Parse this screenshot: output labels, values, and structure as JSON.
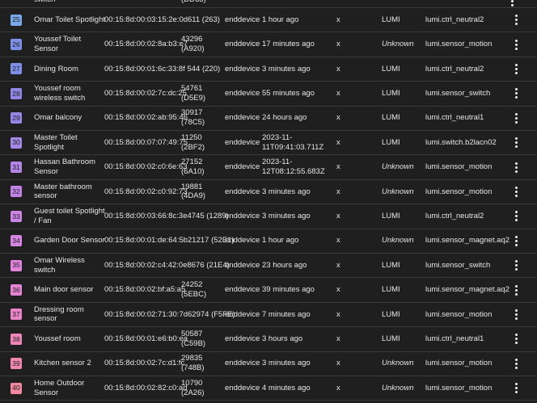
{
  "partial_row": {
    "name": "switch",
    "nwk": "(DD63)"
  },
  "rows": [
    {
      "id": "25",
      "color": "#7aa7e8",
      "name": "Omar Toilet Spotlight",
      "ieee": "00:15:8d:00:03:15:2e:0d611 (263)",
      "nwk": "",
      "type": "enddevice",
      "seen": "1 hour ago",
      "x": "x",
      "manu": "LUMI",
      "model": "lumi.ctrl_neutral2"
    },
    {
      "id": "26",
      "color": "#7e8fe8",
      "name": "Youssef Toilet Sensor",
      "ieee": "00:15:8d:00:02:8a:b3:e7",
      "nwk": "43296 (A920)",
      "type": "enddevice",
      "seen": "17 minutes ago",
      "x": "x",
      "manu": "Unknown",
      "model": "lumi.sensor_motion"
    },
    {
      "id": "27",
      "color": "#7e8fe8",
      "name": "Dining Room",
      "ieee": "00:15:8d:00:01:6c:33:8f 544 (220)",
      "nwk": "",
      "type": "enddevice",
      "seen": "3 minutes ago",
      "x": "x",
      "manu": "LUMI",
      "model": "lumi.ctrl_neutral2"
    },
    {
      "id": "28",
      "color": "#8f86e6",
      "name": "Youssef room wireless switch",
      "ieee": "00:15:8d:00:02:7c:dc:25",
      "nwk": "54761 (D5E9)",
      "type": "enddevice",
      "seen": "55 minutes ago",
      "x": "x",
      "manu": "LUMI",
      "model": "lumi.sensor_switch"
    },
    {
      "id": "29",
      "color": "#9485e6",
      "name": "Omar balcony",
      "ieee": "00:15:8d:00:02:ab:95:46",
      "nwk": "30917 (78C5)",
      "type": "enddevice",
      "seen": "24 hours ago",
      "x": "x",
      "manu": "LUMI",
      "model": "lumi.ctrl_neutral1"
    },
    {
      "id": "30",
      "color": "#a487e6",
      "name": "Master Toilet Spotlight",
      "ieee": "00:15:8d:00:07:07:49:75",
      "nwk": "11250 (2BF2)",
      "type": "enddevice",
      "seen": "2023-11-11T09:41:03.711Z",
      "x": "x",
      "manu": "LUMI",
      "model": "lumi.switch.b2lacn02"
    },
    {
      "id": "31",
      "color": "#b285e6",
      "name": "Hassan Bathroom Sensor",
      "ieee": "00:15:8d:00:02:c0:6e:63",
      "nwk": "27152 (6A10)",
      "type": "enddevice",
      "seen": "2023-11-12T08:12:55.683Z",
      "x": "x",
      "manu": "Unknown",
      "model": "lumi.sensor_motion"
    },
    {
      "id": "32",
      "color": "#c184e6",
      "name": "Master bathroom sensor",
      "ieee": "00:15:8d:00:02:c0:92:73",
      "nwk": "19881 (4DA9)",
      "type": "enddevice",
      "seen": "3 minutes ago",
      "x": "x",
      "manu": "Unknown",
      "model": "lumi.sensor_motion"
    },
    {
      "id": "33",
      "color": "#cc84e6",
      "name": "Guest toilet Spotlight / Fan",
      "ieee": "00:15:8d:00:03:66:8c:3e4745 (1289)",
      "nwk": "",
      "type": "enddevice",
      "seen": "3 minutes ago",
      "x": "x",
      "manu": "LUMI",
      "model": "lumi.ctrl_neutral2"
    },
    {
      "id": "34",
      "color": "#d884e4",
      "name": "Garden Door Sensor",
      "ieee": "00:15:8d:00:01:de:64:5b21217 (52E1)",
      "nwk": "",
      "type": "enddevice",
      "seen": "1 hour ago",
      "x": "x",
      "manu": "Unknown",
      "model": "lumi.sensor_magnet.aq2"
    },
    {
      "id": "35",
      "color": "#e084de",
      "name": "Omar Wireless switch",
      "ieee": "00:15:8d:00:02:c4:42:0e8676 (21E4)",
      "nwk": "",
      "type": "enddevice",
      "seen": "23 hours ago",
      "x": "x",
      "manu": "LUMI",
      "model": "lumi.sensor_switch"
    },
    {
      "id": "36",
      "color": "#e684d4",
      "name": "Main door sensor",
      "ieee": "00:15:8d:00:02:bf:a5:a5",
      "nwk": "24252 (5EBC)",
      "type": "enddevice",
      "seen": "39 minutes ago",
      "x": "x",
      "manu": "LUMI",
      "model": "lumi.sensor_magnet.aq2"
    },
    {
      "id": "37",
      "color": "#ea84c8",
      "name": "Dressing room sensor",
      "ieee": "00:15:8d:00:02:71:30:7d62974 (F5FE)",
      "nwk": "",
      "type": "enddevice",
      "seen": "7 minutes ago",
      "x": "x",
      "manu": "LUMI",
      "model": "lumi.sensor_motion"
    },
    {
      "id": "38",
      "color": "#ee86bb",
      "name": "Youssef room",
      "ieee": "00:15:8d:00:01:e6:b0:ea",
      "nwk": "50587 (C59B)",
      "type": "enddevice",
      "seen": "3 hours ago",
      "x": "x",
      "manu": "LUMI",
      "model": "lumi.ctrl_neutral1"
    },
    {
      "id": "39",
      "color": "#f087ae",
      "name": "Kitchen sensor 2",
      "ieee": "00:15:8d:00:02:7c:d1:fc",
      "nwk": "29835 (748B)",
      "type": "enddevice",
      "seen": "3 minutes ago",
      "x": "x",
      "manu": "Unknown",
      "model": "lumi.sensor_motion"
    },
    {
      "id": "40",
      "color": "#f2889f",
      "name": "Home Outdoor Sensor",
      "ieee": "00:15:8d:00:02:82:c0:ad",
      "nwk": "10790 (2A26)",
      "type": "enddevice",
      "seen": "4 minutes ago",
      "x": "x",
      "manu": "Unknown",
      "model": "lumi.sensor_motion"
    }
  ]
}
